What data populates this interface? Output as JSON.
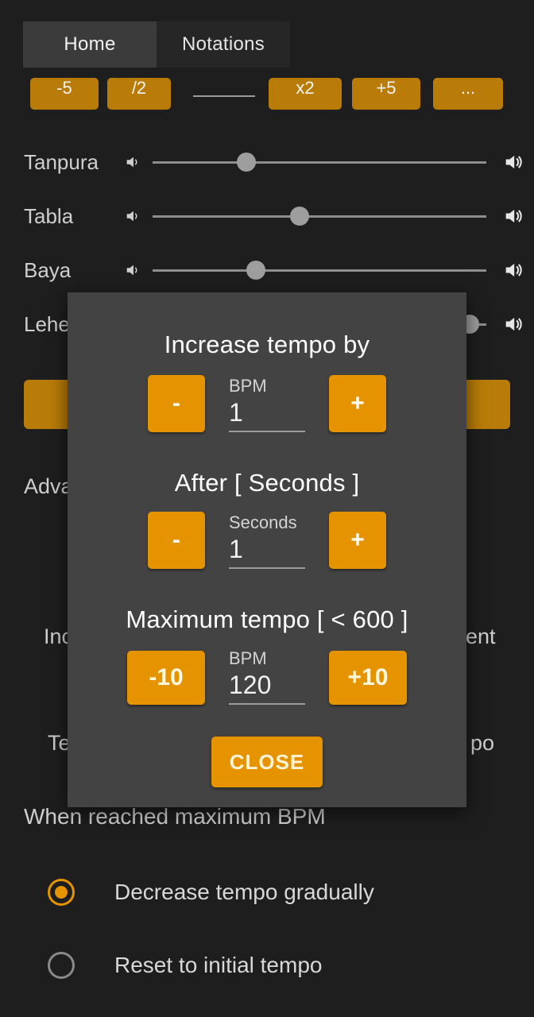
{
  "app": {
    "tabs": [
      {
        "label": "Home",
        "active": true
      },
      {
        "label": "Notations",
        "active": false
      }
    ],
    "quick_buttons": [
      {
        "label": "-5"
      },
      {
        "label": "/2"
      },
      {
        "label": "x2"
      },
      {
        "label": "+5"
      },
      {
        "label": "..."
      }
    ],
    "sliders": [
      {
        "label": "Tanpura",
        "value": 28,
        "left_icon": "volume-low-icon",
        "right_icon": "volume-high-icon"
      },
      {
        "label": "Tabla",
        "value": 44,
        "left_icon": "volume-low-icon",
        "right_icon": "volume-high-icon"
      },
      {
        "label": "Baya",
        "value": 31,
        "left_icon": "volume-low-icon",
        "right_icon": "volume-high-icon"
      },
      {
        "label": "Lehera",
        "value": 95,
        "left_icon": "volume-low-icon",
        "right_icon": "volume-high-icon"
      }
    ],
    "background_labels": {
      "advanced": "Adva",
      "increase_left": "Inc",
      "increase_right": "ent",
      "tempo_left": "Te",
      "tempo_right": "po"
    },
    "when_max_heading": "When reached maximum BPM",
    "radio_options": [
      {
        "label": "Decrease tempo gradually",
        "selected": true
      },
      {
        "label": "Reset to initial tempo",
        "selected": false
      }
    ]
  },
  "dialog": {
    "sections": [
      {
        "title": "Increase tempo by",
        "caption": "BPM",
        "value": "1",
        "dec_label": "-",
        "inc_label": "+"
      },
      {
        "title": "After [ Seconds ]",
        "caption": "Seconds",
        "value": "1",
        "dec_label": "-",
        "inc_label": "+"
      },
      {
        "title": "Maximum tempo [ < 600 ]",
        "caption": "BPM",
        "value": "120",
        "dec_label": "-10",
        "inc_label": "+10"
      }
    ],
    "close_label": "CLOSE"
  },
  "colors": {
    "accent": "#e59400",
    "accent_dim": "#b97c08",
    "dialog_bg": "#434343",
    "page_bg": "#1e1e1e",
    "tab_active_bg": "#3b3b3b"
  }
}
